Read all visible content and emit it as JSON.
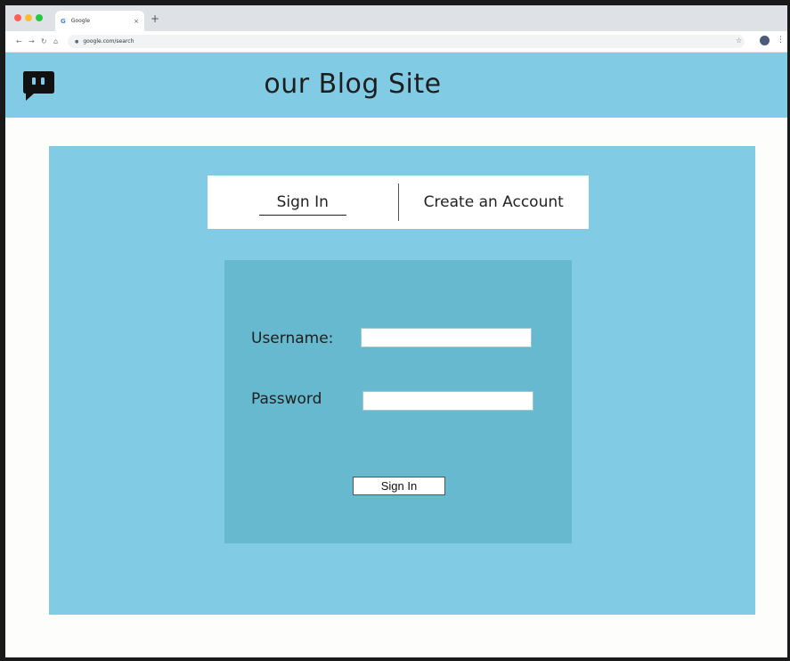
{
  "browser": {
    "tab_title": "Google",
    "tab_favicon": "G",
    "tab_close": "×",
    "new_tab": "+",
    "url": "google.com/search",
    "icons": [
      "back-arrow-icon",
      "forward-arrow-icon",
      "reload-icon",
      "home-icon",
      "lock-icon",
      "star-icon",
      "profile-icon",
      "kebab-menu-icon"
    ]
  },
  "site": {
    "title": "our Blog Site",
    "logo_icon": "speech-bubble-icon",
    "header_color": "#82cbe4"
  },
  "auth_tabs": {
    "sign_in": "Sign In",
    "create_account": "Create an Account"
  },
  "form": {
    "username_label": "Username:",
    "password_label": "Password",
    "username_value": "",
    "password_value": "",
    "submit_label": "Sign In",
    "panel_color": "#67b9cf"
  }
}
